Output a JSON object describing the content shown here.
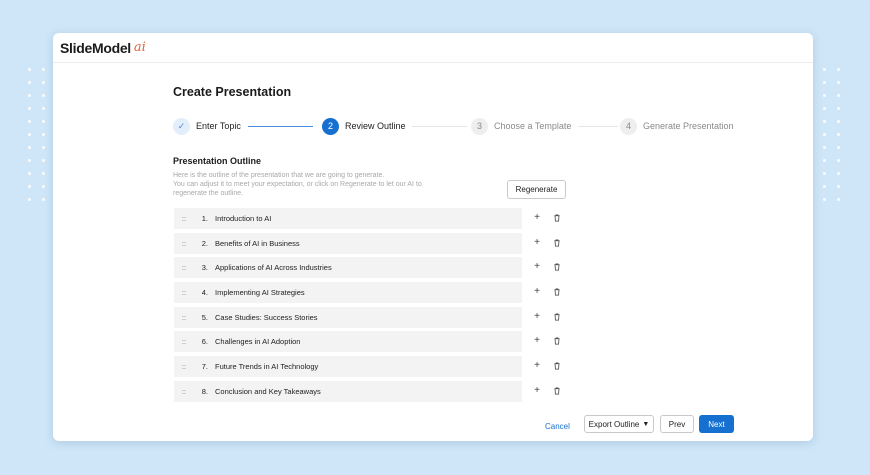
{
  "app": {
    "logo_text": "SlideModel",
    "logo_suffix": "ai"
  },
  "page": {
    "title": "Create Presentation"
  },
  "stepper": {
    "steps": [
      {
        "number": "✓",
        "label": "Enter Topic",
        "state": "done"
      },
      {
        "number": "2",
        "label": "Review Outline",
        "state": "active"
      },
      {
        "number": "3",
        "label": "Choose a Template",
        "state": "todo"
      },
      {
        "number": "4",
        "label": "Generate Presentation",
        "state": "todo"
      }
    ]
  },
  "outline": {
    "title": "Presentation Outline",
    "description_line1": "Here is the outline of the presentation that we are going to generate.",
    "description_line2": "You can adjust it to meet your expectation, or click on Regenerate to let our AI to",
    "description_line3": "regenerate the outline.",
    "regenerate_label": "Regenerate",
    "items": [
      {
        "drag": "::",
        "number": "1.",
        "title": "Introduction to AI"
      },
      {
        "drag": "::",
        "number": "2.",
        "title": "Benefits of AI in Business"
      },
      {
        "drag": "::",
        "number": "3.",
        "title": "Applications of AI Across Industries"
      },
      {
        "drag": "::",
        "number": "4.",
        "title": "Implementing AI Strategies"
      },
      {
        "drag": "::",
        "number": "5.",
        "title": "Case Studies: Success Stories"
      },
      {
        "drag": "::",
        "number": "6.",
        "title": "Challenges in AI Adoption"
      },
      {
        "drag": "::",
        "number": "7.",
        "title": "Future Trends in AI Technology"
      },
      {
        "drag": "::",
        "number": "8.",
        "title": "Conclusion and Key Takeaways"
      }
    ],
    "add_symbol": "+",
    "add_icon": "plus-icon",
    "delete_icon": "trash-icon"
  },
  "footer": {
    "cancel_label": "Cancel",
    "export_label": "Export Outline",
    "export_caret": "▼",
    "prev_label": "Prev",
    "next_label": "Next"
  },
  "colors": {
    "accent": "#1570cf",
    "background": "#cfe6f8",
    "row_background": "#f3f3f3",
    "logo_ai": "#e0643a"
  }
}
